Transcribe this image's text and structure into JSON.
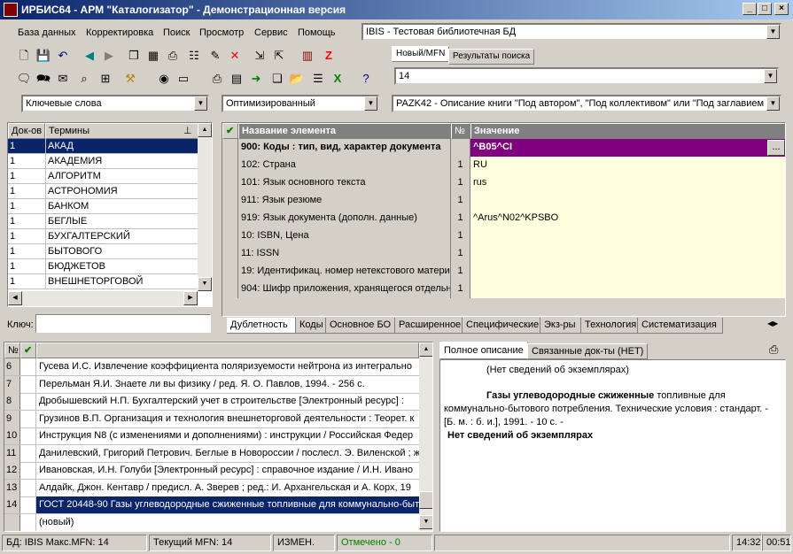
{
  "window": {
    "title": "ИРБИС64 - АРМ \"Каталогизатор\" - Демонстрационная версия"
  },
  "menu": [
    "База данных",
    "Корректировка",
    "Поиск",
    "Просмотр",
    "Сервис",
    "Помощь"
  ],
  "database_select": "IBIS - Тестовая библиотечная БД",
  "record_tabs": [
    "Новый/MFN",
    "Результаты поиска"
  ],
  "mfn_value": "14",
  "search_mode": "Ключевые слова",
  "optimization_mode": "Оптимизированный",
  "worksheet": "PAZK42 - Описание книги \"Под автором\", \"Под коллективом\" или \"Под заглавием\"",
  "terms": {
    "headers": [
      "Док-ов",
      "Термины"
    ],
    "rows": [
      [
        "1",
        "АКАД"
      ],
      [
        "1",
        "АКАДЕМИЯ"
      ],
      [
        "1",
        "АЛГОРИТМ"
      ],
      [
        "1",
        "АСТРОНОМИЯ"
      ],
      [
        "1",
        "БАНКОМ"
      ],
      [
        "1",
        "БЕГЛЫЕ"
      ],
      [
        "1",
        "БУХГАЛТЕРСКИЙ"
      ],
      [
        "1",
        "БЫТОВОГО"
      ],
      [
        "1",
        "БЮДЖЕТОВ"
      ],
      [
        "1",
        "ВНЕШНЕТОРГОВОЙ"
      ]
    ],
    "key_label": "Ключ:"
  },
  "grid": {
    "headers": [
      "Название элемента",
      "№",
      "Значение"
    ],
    "rows": [
      [
        "900: Коды : тип, вид, характер документа",
        "",
        "^B05^CI"
      ],
      [
        "102: Страна",
        "1",
        "RU"
      ],
      [
        "101: Язык основного текста",
        "1",
        "rus"
      ],
      [
        "911: Язык резюме",
        "1",
        ""
      ],
      [
        "919: Язык документа (дополн. данные)",
        "1",
        "^Arus^N02^KPSBO"
      ],
      [
        "10: ISBN, Цена",
        "1",
        ""
      ],
      [
        "11: ISSN",
        "1",
        ""
      ],
      [
        "19: Идентификац. номер нетекстового матери",
        "1",
        ""
      ],
      [
        "904: Шифр приложения, хранящегося отдельно",
        "1",
        ""
      ]
    ],
    "ellipsis": "..."
  },
  "page_tabs": [
    "Дублетность",
    "Коды",
    "Основное БО",
    "Расширенное",
    "Специфические",
    "Экз-ры",
    "Технология",
    "Систематизация"
  ],
  "records": {
    "header_no": "№",
    "rows": [
      [
        "6",
        "Гусева И.С. Извлечение коэффициента поляризуемости нейтрона из интегрально"
      ],
      [
        "7",
        "Перельман Я.И. Знаете ли вы физику / ред. Я. О. Павлов, 1994. - 256 с."
      ],
      [
        "8",
        "Дробышевский Н.П. Бухгалтерский учет в строительстве [Электронный ресурс] :"
      ],
      [
        "9",
        "Грузинов В.П. Организация и технология внешнеторговой деятельности : Теорет. к"
      ],
      [
        "10",
        "Инструкция N8  (с изменениями и дополнениями) : инструкции / Российская Федер"
      ],
      [
        "11",
        "Данилевский, Григорий Петрович. Беглые в Новороссии / послесл. Э. Виленской ; ж"
      ],
      [
        "12",
        "Ивановская, И.Н. Голуби [Электронный ресурс] : справочное издание / И.Н. Ивано"
      ],
      [
        "13",
        "Алдайк, Джон. Кентавр / предисл. А. Зверев ; ред.: И. Архангельская и А. Корх, 19"
      ],
      [
        "14",
        "ГОСТ 20448-90 Газы углеводородные сжиженные топливные для коммунально-быт"
      ],
      [
        "",
        "(новый)"
      ]
    ]
  },
  "desc_tabs": [
    "Полное описание",
    "Связанные док-ты (НЕТ)"
  ],
  "description": {
    "line1": "(Нет сведений об экземплярах)",
    "bold_title": "Газы углеводородные сжиженные",
    "body": " топливные для коммунально-бытового потребления. Технические условия : стандарт. - [Б. м. : б. и.], 1991. - 10 с. -",
    "line_end": "Нет сведений об экземплярах"
  },
  "status": {
    "db": "БД: IBIS Макс.MFN: 14",
    "current": "Текущий MFN: 14",
    "changed": "ИЗМЕН.",
    "marked": "Отмечено - 0",
    "time": "14:32",
    "sec": "00:51"
  },
  "colors": {
    "title_start": "#0a246a",
    "title_end": "#a6caf0",
    "selection": "#0a246a",
    "highlight_row": "#800080",
    "grid_bg": "#ffffe0",
    "marked_text": "#008000"
  }
}
